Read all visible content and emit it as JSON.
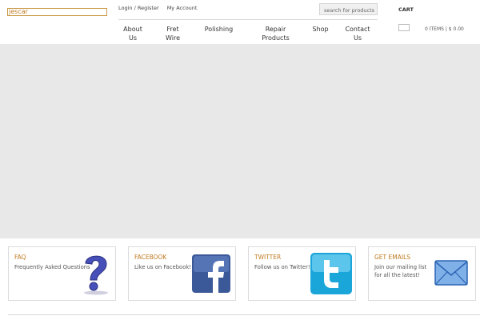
{
  "header": {
    "logo_text": "jescar",
    "login_link": "Login / Register",
    "account_link": "My Account",
    "search_placeholder": "search for products",
    "cart_label": "CART",
    "cart_summary": "0 ITEMS | $ 0.00"
  },
  "nav": {
    "items": [
      {
        "line1": "About",
        "line2": "Us"
      },
      {
        "line1": "Fret",
        "line2": "Wire"
      },
      {
        "line1": "Polishing",
        "line2": ""
      },
      {
        "line1": "Repair",
        "line2": "Products"
      },
      {
        "line1": "Shop",
        "line2": ""
      },
      {
        "line1": "Contact",
        "line2": "Us"
      }
    ]
  },
  "cards": [
    {
      "title": "FAQ",
      "line1": "Frequently Asked Questions",
      "line2": "",
      "icon": "question-mark-icon"
    },
    {
      "title": "FACEBOOK",
      "line1": "Like us on Facebook!",
      "line2": "",
      "icon": "facebook-icon"
    },
    {
      "title": "TWITTER",
      "line1": "Follow us on Twitter!",
      "line2": "",
      "icon": "twitter-icon"
    },
    {
      "title": "GET EMAILS",
      "line1": "Join our mailing list",
      "line2": "for all the latest!",
      "icon": "envelope-icon"
    }
  ],
  "colors": {
    "accent": "#c07a20",
    "banner": "#e8e8e8",
    "facebook": "#3b5998",
    "twitter": "#1ba6d9"
  }
}
